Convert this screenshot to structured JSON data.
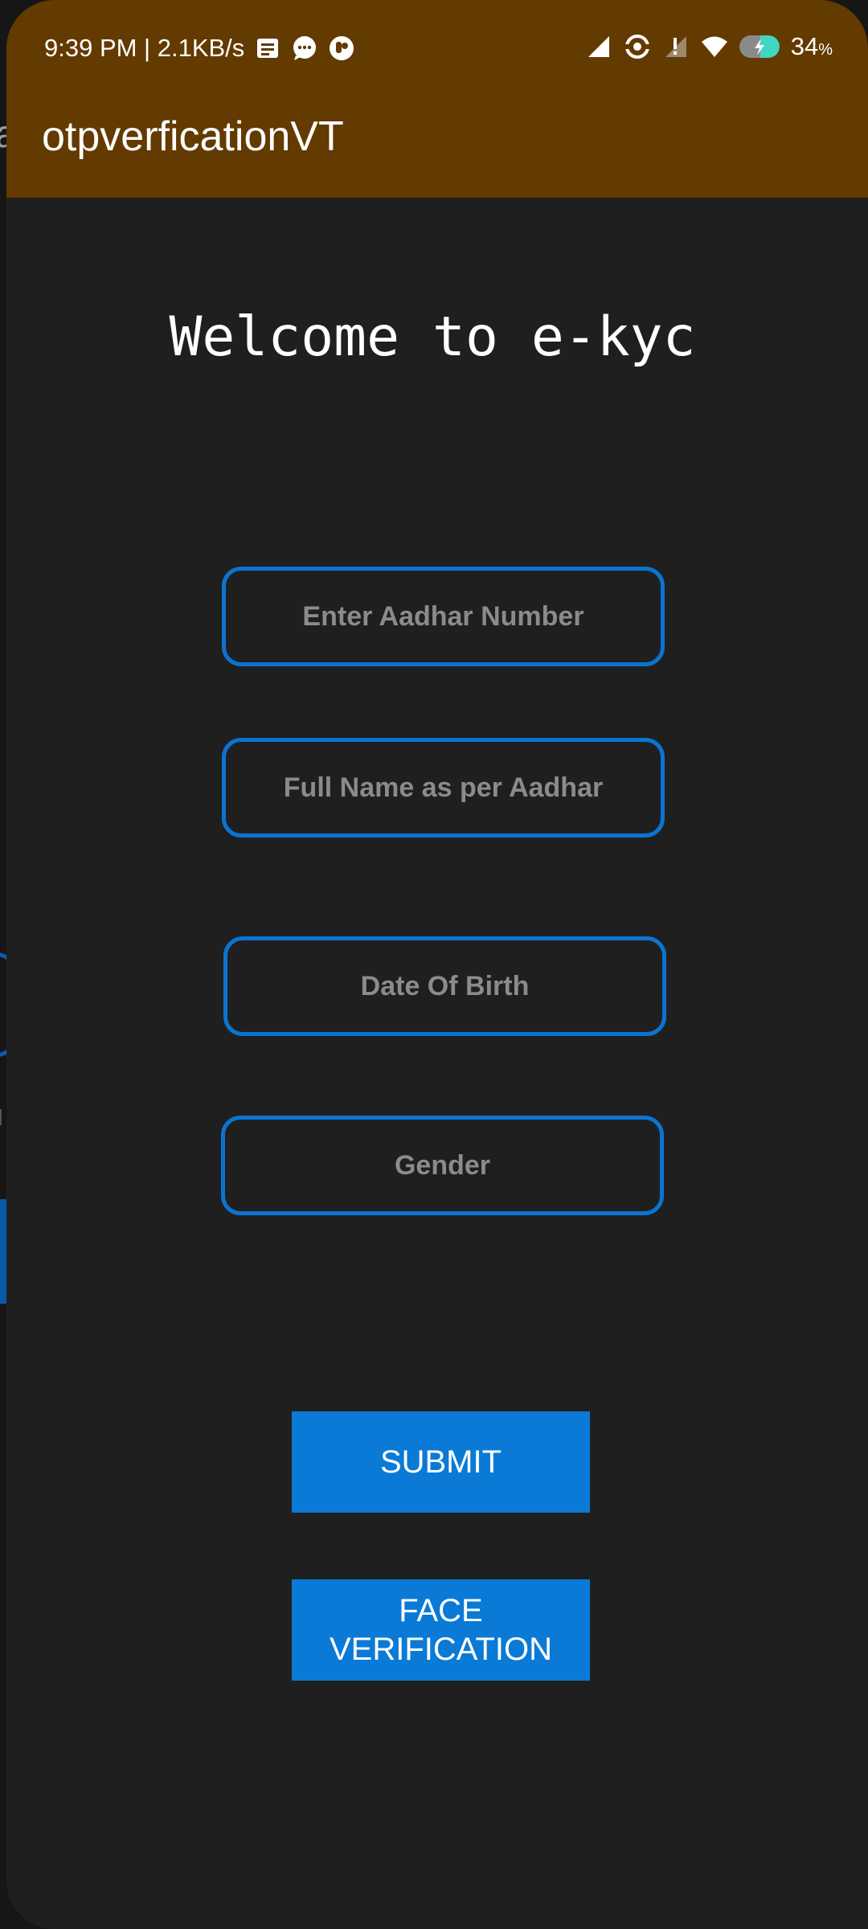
{
  "status_bar": {
    "time_and_speed": "9:39 PM | 2.1KB/s",
    "battery_value": "34",
    "battery_unit": "%",
    "icons": [
      "notification-list-icon",
      "chat-bubble-icon",
      "app-badge-icon",
      "signal-icon",
      "hotspot-icon",
      "data-signal-icon",
      "wifi-icon",
      "battery-charging-icon"
    ]
  },
  "app_bar": {
    "title": "otpverficationVT",
    "color": "#633a00"
  },
  "main": {
    "welcome_text": "Welcome to e-kyc",
    "fields": {
      "aadhar_placeholder": "Enter Aadhar Number",
      "name_placeholder": "Full Name as per Aadhar",
      "dob_placeholder": "Date Of Birth",
      "gender_placeholder": "Gender"
    },
    "buttons": {
      "submit_label": "SUBMIT",
      "face_line1": "FACE",
      "face_line2": "VERIFICATION"
    }
  },
  "colors": {
    "accent": "#0a7ad6",
    "background": "#1f1f1f"
  }
}
